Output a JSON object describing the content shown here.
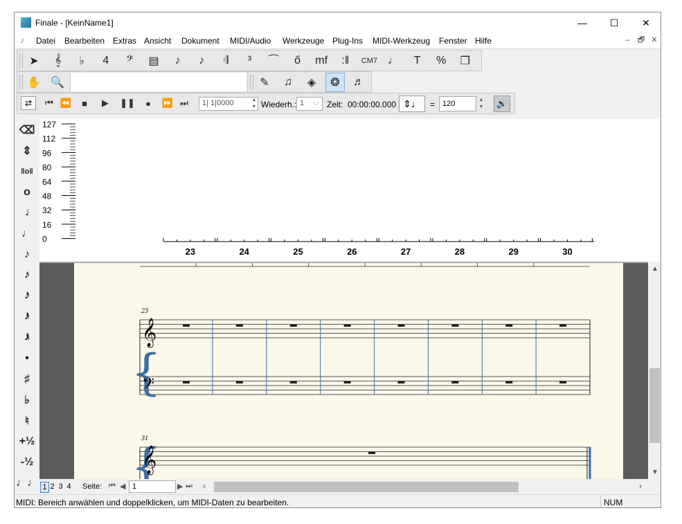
{
  "window": {
    "title": "Finale  - [KeinName1]",
    "minimize": "—",
    "maximize": "☐",
    "close": "✕"
  },
  "menu": [
    "Datei",
    "Bearbeiten",
    "Extras",
    "Ansicht",
    "Dokument",
    "MIDI/Audio",
    "Werkzeuge",
    "Plug-Ins",
    "MIDI-Werkzeug",
    "Fenster",
    "Hilfe"
  ],
  "mdi": {
    "minimize": "–",
    "restore": "🗗",
    "close": "✕"
  },
  "main_tools": [
    {
      "name": "selection-tool",
      "glyph": "➤"
    },
    {
      "name": "staff-tool",
      "glyph": "𝄞"
    },
    {
      "name": "key-signature-tool",
      "glyph": "♭"
    },
    {
      "name": "time-signature-tool",
      "glyph": "4"
    },
    {
      "name": "clef-tool",
      "glyph": "𝄢"
    },
    {
      "name": "measure-tool",
      "glyph": "▤"
    },
    {
      "name": "simple-entry-tool",
      "glyph": "♪"
    },
    {
      "name": "speedy-entry-tool",
      "glyph": "♪"
    },
    {
      "name": "articulation-tool",
      "glyph": "𝄇"
    },
    {
      "name": "tuplet-tool",
      "glyph": "³"
    },
    {
      "name": "smart-shape-tool",
      "glyph": "⁀"
    },
    {
      "name": "lyrics-tool",
      "glyph": "ő"
    },
    {
      "name": "expression-tool",
      "glyph": "mf"
    },
    {
      "name": "repeat-tool",
      "glyph": ":‖"
    },
    {
      "name": "chord-tool",
      "glyph": "CM7"
    },
    {
      "name": "ossia-tool",
      "glyph": "♩"
    },
    {
      "name": "text-tool",
      "glyph": "T"
    },
    {
      "name": "resize-tool",
      "glyph": "%"
    },
    {
      "name": "page-layout-tool",
      "glyph": "❐"
    }
  ],
  "second_tools": [
    {
      "name": "hand-grabber-tool",
      "glyph": "✋"
    },
    {
      "name": "zoom-tool",
      "glyph": "🔍"
    }
  ],
  "third_tools": [
    {
      "name": "graphics-tool",
      "glyph": "✎"
    },
    {
      "name": "mirror-tool",
      "glyph": "♫"
    },
    {
      "name": "special-tools",
      "glyph": "◈"
    },
    {
      "name": "midi-tool",
      "glyph": "❂"
    },
    {
      "name": "human-playback-tool",
      "glyph": "♬"
    }
  ],
  "playback": {
    "counter": "1| 1|0000",
    "repeat_label": "Wiederh.:",
    "repeat_value": "1",
    "time_label": "Zeit:",
    "time_value": "00:00:00.000",
    "tempo_eq": "=",
    "tempo_value": "120"
  },
  "palette": [
    {
      "name": "eraser-icon",
      "glyph": "⌫"
    },
    {
      "name": "flip-icon",
      "glyph": "⇕"
    },
    {
      "name": "double-whole-note-icon",
      "glyph": "‖o‖"
    },
    {
      "name": "whole-note-icon",
      "glyph": "o"
    },
    {
      "name": "half-note-icon",
      "glyph": "𝅗𝅥"
    },
    {
      "name": "quarter-note-icon",
      "glyph": "♩"
    },
    {
      "name": "eighth-note-icon",
      "glyph": "♪"
    },
    {
      "name": "sixteenth-note-icon",
      "glyph": "𝅘𝅥𝅯"
    },
    {
      "name": "thirty-second-note-icon",
      "glyph": "𝅘𝅥𝅰"
    },
    {
      "name": "sixty-fourth-note-icon",
      "glyph": "𝅘𝅥𝅱"
    },
    {
      "name": "hundred-twenty-eighth-note-icon",
      "glyph": "𝅘𝅥𝅲"
    },
    {
      "name": "dot-icon",
      "glyph": "•"
    },
    {
      "name": "sharp-icon",
      "glyph": "♯"
    },
    {
      "name": "flat-icon",
      "glyph": "♭"
    },
    {
      "name": "natural-icon",
      "glyph": "♮"
    },
    {
      "name": "half-step-up-icon",
      "glyph": "+½"
    },
    {
      "name": "half-step-down-icon",
      "glyph": "-½"
    },
    {
      "name": "tie-icon",
      "glyph": "♩♩"
    }
  ],
  "velocity_labels": [
    "127",
    "112",
    "96",
    "80",
    "64",
    "48",
    "32",
    "16",
    "0"
  ],
  "measure_numbers": [
    "23",
    "24",
    "25",
    "26",
    "27",
    "28",
    "29",
    "30"
  ],
  "score": {
    "system1_number": "23",
    "system2_number": "31"
  },
  "pages": [
    "1",
    "2",
    "3",
    "4"
  ],
  "page_label": "Seite:",
  "page_value": "1",
  "status": {
    "message": "MIDI: Bereich anwählen und doppelklicken,  um MIDI-Daten zu bearbeiten.",
    "num": "NUM"
  }
}
